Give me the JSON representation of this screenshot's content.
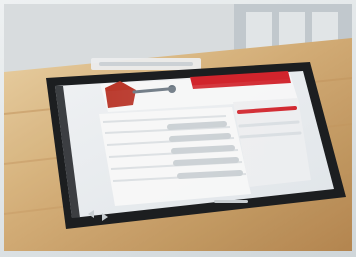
{
  "photo": {
    "subject": "",
    "kiosk_label": "",
    "screen": {
      "header_bar_color": "#d8262e",
      "accent_color": "#c0392b",
      "panel_color": "#f4f6f8"
    }
  },
  "colors": {
    "table_wood": "#d9b27a",
    "table_wood_dark": "#b98a52",
    "bezel": "#1d1f22",
    "wall": "#dfe4e6"
  },
  "icons": {
    "back": "triangle-left-icon",
    "forward": "triangle-right-icon"
  }
}
